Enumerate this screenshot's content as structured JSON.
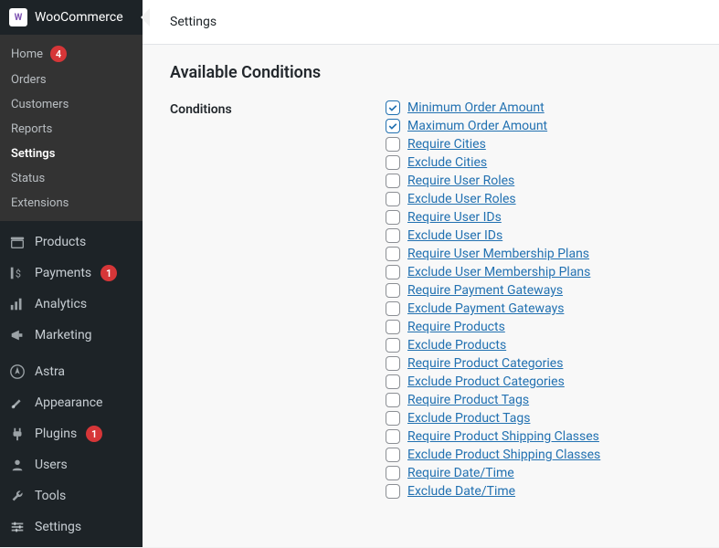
{
  "header": {
    "brand": "WooCommerce",
    "page_title": "Settings"
  },
  "subnav": {
    "items": [
      {
        "label": "Home",
        "badge": "4"
      },
      {
        "label": "Orders"
      },
      {
        "label": "Customers"
      },
      {
        "label": "Reports"
      },
      {
        "label": "Settings",
        "active": true
      },
      {
        "label": "Status"
      },
      {
        "label": "Extensions"
      }
    ]
  },
  "mainnav": {
    "items": [
      {
        "label": "Products",
        "icon": "archive"
      },
      {
        "label": "Payments",
        "icon": "dollar",
        "badge": "1"
      },
      {
        "label": "Analytics",
        "icon": "chart"
      },
      {
        "label": "Marketing",
        "icon": "megaphone"
      },
      {
        "label": "Astra",
        "icon": "astra",
        "divider_before": true
      },
      {
        "label": "Appearance",
        "icon": "brush"
      },
      {
        "label": "Plugins",
        "icon": "plug",
        "badge": "1"
      },
      {
        "label": "Users",
        "icon": "user"
      },
      {
        "label": "Tools",
        "icon": "wrench"
      },
      {
        "label": "Settings",
        "icon": "sliders"
      }
    ]
  },
  "section": {
    "title": "Available Conditions",
    "row_label": "Conditions"
  },
  "conditions": [
    {
      "label": "Minimum Order Amount",
      "checked": true
    },
    {
      "label": "Maximum Order Amount",
      "checked": true
    },
    {
      "label": "Require Cities",
      "checked": false
    },
    {
      "label": "Exclude Cities",
      "checked": false
    },
    {
      "label": "Require User Roles",
      "checked": false
    },
    {
      "label": "Exclude User Roles",
      "checked": false
    },
    {
      "label": "Require User IDs",
      "checked": false
    },
    {
      "label": "Exclude User IDs",
      "checked": false
    },
    {
      "label": "Require User Membership Plans",
      "checked": false
    },
    {
      "label": "Exclude User Membership Plans",
      "checked": false
    },
    {
      "label": "Require Payment Gateways",
      "checked": false
    },
    {
      "label": "Exclude Payment Gateways",
      "checked": false
    },
    {
      "label": "Require Products",
      "checked": false
    },
    {
      "label": "Exclude Products",
      "checked": false
    },
    {
      "label": "Require Product Categories",
      "checked": false
    },
    {
      "label": "Exclude Product Categories",
      "checked": false
    },
    {
      "label": "Require Product Tags",
      "checked": false
    },
    {
      "label": "Exclude Product Tags",
      "checked": false
    },
    {
      "label": "Require Product Shipping Classes",
      "checked": false
    },
    {
      "label": "Exclude Product Shipping Classes",
      "checked": false
    },
    {
      "label": "Require Date/Time",
      "checked": false
    },
    {
      "label": "Exclude Date/Time",
      "checked": false
    }
  ]
}
